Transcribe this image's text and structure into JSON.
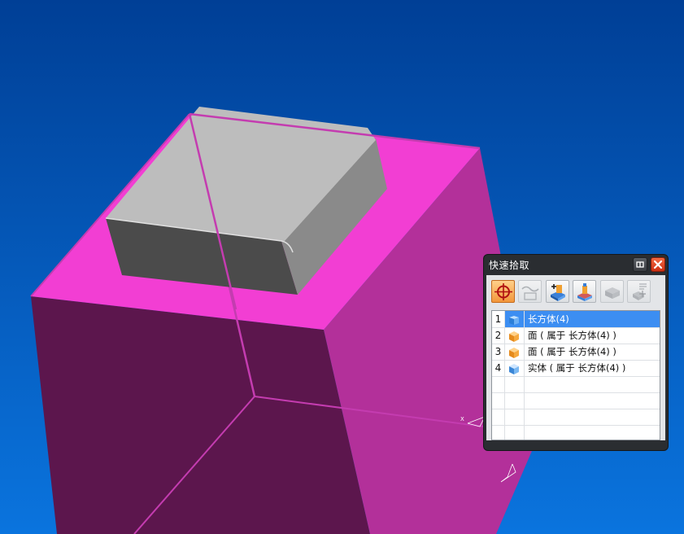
{
  "colors": {
    "background_top": "#003f96",
    "background_bottom": "#0a74de",
    "block_top": "#f23ed3",
    "block_front": "#5c164d",
    "block_side": "#b3309a",
    "block_edge": "#c43cb0",
    "boss_top": "#bdbdbd",
    "boss_front": "#4b4b4b",
    "boss_side": "#8a8a8a",
    "selection": "#3c8ef2"
  },
  "viewport": {
    "axis_label": "X"
  },
  "quick_pick": {
    "title": "快速拾取",
    "tools": [
      {
        "icon": "crosshair-icon",
        "state": "active"
      },
      {
        "icon": "curve-icon",
        "state": "disabled"
      },
      {
        "icon": "add-feature-icon",
        "state": "normal"
      },
      {
        "icon": "body-feature-icon",
        "state": "normal"
      },
      {
        "icon": "solid-body-icon",
        "state": "disabled"
      },
      {
        "icon": "component-icon",
        "state": "disabled"
      }
    ],
    "items": [
      {
        "num": "1",
        "icon": "block-blue-icon",
        "label": "长方体(4)",
        "selected": true
      },
      {
        "num": "2",
        "icon": "face-orange-icon",
        "label": "面 ( 属于 长方体(4) )",
        "selected": false
      },
      {
        "num": "3",
        "icon": "face-orange-icon",
        "label": "面 ( 属于 长方体(4) )",
        "selected": false
      },
      {
        "num": "4",
        "icon": "body-blue-icon",
        "label": "实体 ( 属于 长方体(4) )",
        "selected": false
      }
    ]
  }
}
